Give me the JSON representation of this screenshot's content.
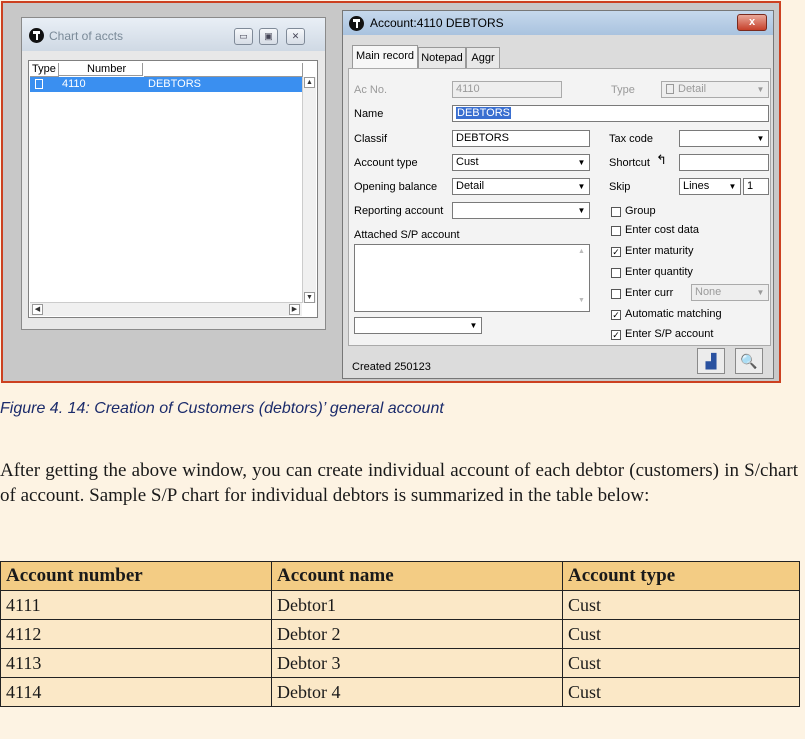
{
  "chart_window": {
    "title": "Chart of accts",
    "columns": [
      "Type",
      "Number"
    ],
    "rows": [
      {
        "number": "4110",
        "name": "DEBTORS"
      }
    ]
  },
  "account_window": {
    "title": "Account:4110 DEBTORS",
    "close_label": "x",
    "tabs": [
      "Main record",
      "Notepad",
      "Aggr"
    ],
    "fields": {
      "ac_no_label": "Ac No.",
      "ac_no_value": "4110",
      "type_label": "Type",
      "type_value": "Detail",
      "name_label": "Name",
      "name_value": "DEBTORS",
      "classif_label": "Classif",
      "classif_value": "DEBTORS",
      "account_type_label": "Account type",
      "account_type_value": "Cust",
      "opening_balance_label": "Opening balance",
      "opening_balance_value": "Detail",
      "reporting_account_label": "Reporting account",
      "reporting_account_value": "",
      "attached_label": "Attached S/P account",
      "tax_code_label": "Tax code",
      "tax_code_value": "",
      "shortcut_label": "Shortcut",
      "shortcut_value": "",
      "skip_label": "Skip",
      "skip_unit": "Lines",
      "skip_value": "1",
      "enter_curr_value": "None"
    },
    "checkboxes": [
      {
        "label": "Group",
        "checked": false
      },
      {
        "label": "Enter cost data",
        "checked": false
      },
      {
        "label": "Enter maturity",
        "checked": true
      },
      {
        "label": "Enter quantity",
        "checked": false
      },
      {
        "label": "Enter curr",
        "checked": false
      },
      {
        "label": "Automatic matching",
        "checked": true
      },
      {
        "label": "Enter S/P account",
        "checked": true
      }
    ],
    "status": "Created 250123"
  },
  "caption": "Figure 4. 14: Creation of Customers (debtors)’ general account",
  "paragraph": "After getting the above window, you can create individual account of each debtor (customers) in S/chart of account. Sample S/P chart for individual debtors is summarized in the table below:",
  "table": {
    "headers": [
      "Account number",
      "Account name",
      "Account type"
    ],
    "rows": [
      [
        "4111",
        "Debtor1",
        "Cust"
      ],
      [
        "4112",
        "Debtor 2",
        "Cust"
      ],
      [
        "4113",
        "Debtor 3",
        "Cust"
      ],
      [
        "4114",
        "Debtor 4",
        "Cust"
      ]
    ]
  }
}
